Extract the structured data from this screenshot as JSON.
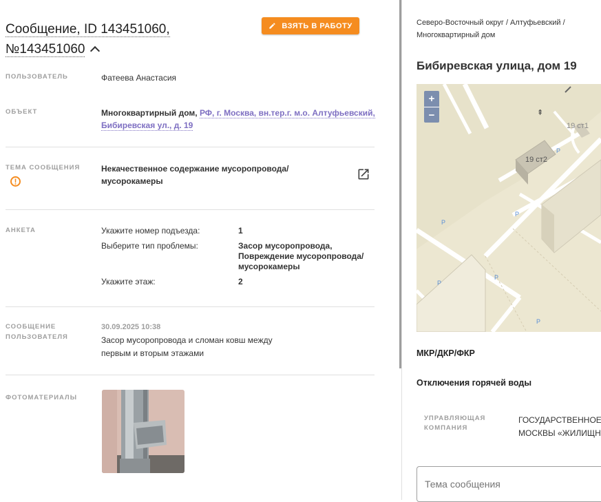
{
  "header": {
    "title_line1": "Сообщение, ID 143451060,",
    "title_line2": "№143451060",
    "take_button": "ВЗЯТЬ В РАБОТУ"
  },
  "fields": {
    "user_label": "ПОЛЬЗОВАТЕЛЬ",
    "user_value": "Фатеева Анастасия",
    "object_label": "ОБЪЕКТ",
    "object_type": "Многоквартирный дом,",
    "object_link_1": "РФ, г. Москва, вн.тер.г. м.о. Алтуфьевский,",
    "object_link_2": "Бибиревская ул., д. 19",
    "topic_label": "ТЕМА СООБЩЕНИЯ",
    "topic_line1": "Некачественное содержание мусоропровода/",
    "topic_line2": "мусорокамеры",
    "survey_label": "АНКЕТА",
    "survey": [
      {
        "q": "Укажите номер подъезда:",
        "a": [
          "1"
        ]
      },
      {
        "q": "Выберите тип проблемы:",
        "a": [
          "Засор мусоропровода,",
          "Повреждение мусоропровода/",
          "мусорокамеры"
        ]
      },
      {
        "q": "Укажите этаж:",
        "a": [
          "2"
        ]
      }
    ],
    "message_label_1": "СООБЩЕНИЕ",
    "message_label_2": "ПОЛЬЗОВАТЕЛЯ",
    "message_date": "30.09.2025 10:38",
    "message_line1": "Засор мусоропровода и сломан ковш между",
    "message_line2": "первым и вторым этажами",
    "photos_label": "ФОТОМАТЕРИАЛЫ"
  },
  "right": {
    "breadcrumb_line1": "Северо-Восточный округ / Алтуфьевский /",
    "breadcrumb_line2": "Многоквартирный дом",
    "address": "Бибиревская улица, дом 19",
    "map": {
      "zoom_in": "+",
      "zoom_out": "−",
      "building_1": "19 ст2",
      "building_2": "19 ст1",
      "parking": "P"
    },
    "section_1": "МКР/ДКР/ФКР",
    "section_2": "Отключения горячей воды",
    "mgmt_label_1": "УПРАВЛЯЮЩАЯ",
    "mgmt_label_2": "КОМПАНИЯ",
    "mgmt_value_1": "ГОСУДАРСТВЕННОЕ",
    "mgmt_value_2": "МОСКВЫ «ЖИЛИЩН",
    "topic_input_placeholder": "Тема сообщения"
  },
  "colors": {
    "accent_orange": "#f58c1f",
    "link_purple": "#7e6fc2",
    "label_gray": "#9e9e9e"
  }
}
